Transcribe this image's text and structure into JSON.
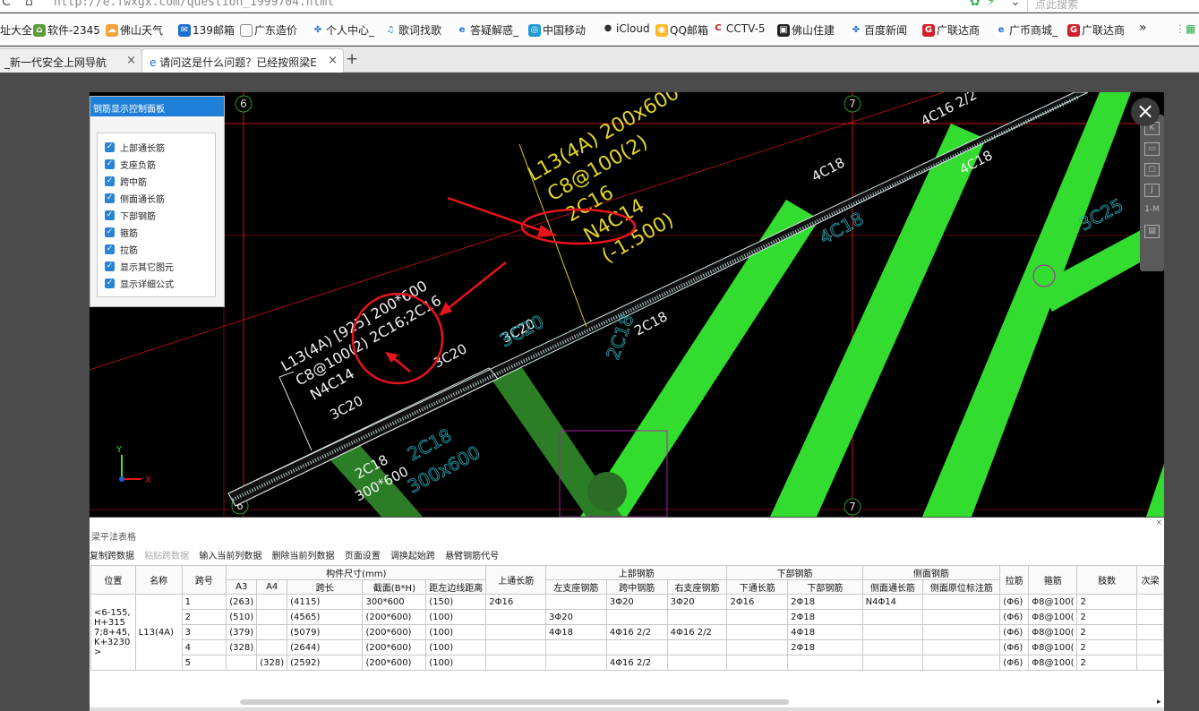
{
  "browser": {
    "url": "http://e.fwxgx.com/question_1999704.html",
    "search_placeholder": "点此搜索",
    "bookmarks": [
      "址大全",
      "软件-2345",
      "佛山天气",
      "139邮箱",
      "广东造价",
      "个人中心_",
      "歌词找歌",
      "答疑解惑_",
      "中国移动",
      "iCloud",
      "QQ邮箱",
      "CCTV-5",
      "佛山住建",
      "百度新闻",
      "广联达商",
      "广币商城_",
      "广联达商"
    ],
    "more": "»",
    "tabs": [
      {
        "label": "_新一代安全上网导航",
        "active": false
      },
      {
        "label": "请问这是什么问题？已经按照梁E",
        "active": true
      }
    ]
  },
  "panel": {
    "title": "钢筋显示控制面板",
    "options": [
      "上部通长筋",
      "支座负筋",
      "跨中筋",
      "侧面通长筋",
      "下部钢筋",
      "箍筋",
      "拉筋",
      "显示其它图元",
      "显示详细公式"
    ]
  },
  "drawing": {
    "axis_labels": [
      "6",
      "7",
      "7",
      "6"
    ],
    "annot_yellow": [
      "L13(4A) 200x600",
      "C8@100(2)",
      "2C16",
      "N4C14",
      "(-1.500)"
    ],
    "annot_white": [
      "L13(4A) [925] 200*600",
      "C8@100(2) 2C16;2C16",
      "N4C14",
      "3C20",
      "3C20",
      "3C20",
      "2C18",
      "300*600",
      "4C18",
      "4C16 2/2",
      "4C18",
      "2C18"
    ],
    "annot_cyan": [
      "3C20",
      "2C18",
      "300x600",
      "4C18",
      "3C25",
      "2C18"
    ],
    "tools": [
      "K",
      "J",
      "1-M"
    ]
  },
  "table": {
    "title": "梁平法表格",
    "toolbar": [
      {
        "label": "复制跨数据",
        "enabled": true
      },
      {
        "label": "粘贴跨数据",
        "enabled": false
      },
      {
        "label": "输入当前列数据",
        "enabled": true
      },
      {
        "label": "删除当前列数据",
        "enabled": true
      },
      {
        "label": "页面设置",
        "enabled": true
      },
      {
        "label": "调换起始跨",
        "enabled": true
      },
      {
        "label": "悬臂钢筋代号",
        "enabled": true
      }
    ],
    "group_headers": {
      "size": "构件尺寸(mm)",
      "top": "上部钢筋",
      "bottom": "下部钢筋",
      "side": "侧面钢筋"
    },
    "headers": {
      "position": "位置",
      "name": "名称",
      "span": "跨号",
      "a3": "A3",
      "a4": "A4",
      "span_len": "跨长",
      "section": "截面(B*H)",
      "edge": "距左边线距离",
      "top_cont": "上通长筋",
      "left_seat": "左支座钢筋",
      "mid": "跨中钢筋",
      "right_seat": "右支座钢筋",
      "bot_cont": "下通长筋",
      "bot_bar": "下部钢筋",
      "side_cont": "侧面通长筋",
      "side_mark": "侧面原位标注筋",
      "tie": "拉筋",
      "stirrup": "箍筋",
      "legs": "肢数",
      "next": "次梁"
    },
    "position_value": "<6-155,H+3157;8+45,K+3230>",
    "name_value": "L13(4A)",
    "rows": [
      {
        "span": "1",
        "a3": "(263)",
        "a4": "",
        "len": "(4115)",
        "sec": "300*600",
        "edge": "(150)",
        "top_cont": "2Φ16",
        "left": "",
        "mid": "3Φ20",
        "right": "3Φ20",
        "bot_cont": "2Φ16",
        "bot": "2Φ18",
        "side_cont": "N4Φ14",
        "side_mark": "",
        "tie": "(Φ6)",
        "stirrup": "Φ8@100(",
        "legs": "2"
      },
      {
        "span": "2",
        "a3": "(510)",
        "a4": "",
        "len": "(4565)",
        "sec": "(200*600)",
        "edge": "(100)",
        "top_cont": "",
        "left": "3Φ20",
        "mid": "",
        "right": "",
        "bot_cont": "",
        "bot": "2Φ18",
        "side_cont": "",
        "side_mark": "",
        "tie": "(Φ6)",
        "stirrup": "Φ8@100(",
        "legs": "2"
      },
      {
        "span": "3",
        "a3": "(379)",
        "a4": "",
        "len": "(5079)",
        "sec": "(200*600)",
        "edge": "(100)",
        "top_cont": "",
        "left": "4Φ18",
        "mid": "4Φ16 2/2",
        "right": "4Φ16 2/2",
        "bot_cont": "",
        "bot": "4Φ18",
        "side_cont": "",
        "side_mark": "",
        "tie": "(Φ6)",
        "stirrup": "Φ8@100(",
        "legs": "2"
      },
      {
        "span": "4",
        "a3": "(328)",
        "a4": "",
        "len": "(2644)",
        "sec": "(200*600)",
        "edge": "(100)",
        "top_cont": "",
        "left": "",
        "mid": "",
        "right": "",
        "bot_cont": "",
        "bot": "2Φ18",
        "side_cont": "",
        "side_mark": "",
        "tie": "(Φ6)",
        "stirrup": "Φ8@100(",
        "legs": "2"
      },
      {
        "span": "5",
        "a3": "",
        "a4": "(328)",
        "len": "(2592)",
        "sec": "(200*600)",
        "edge": "(100)",
        "top_cont": "",
        "left": "",
        "mid": "4Φ16 2/2",
        "right": "",
        "bot_cont": "",
        "bot": "",
        "side_cont": "",
        "side_mark": "",
        "tie": "(Φ6)",
        "stirrup": "Φ8@100(",
        "legs": "2"
      }
    ]
  }
}
